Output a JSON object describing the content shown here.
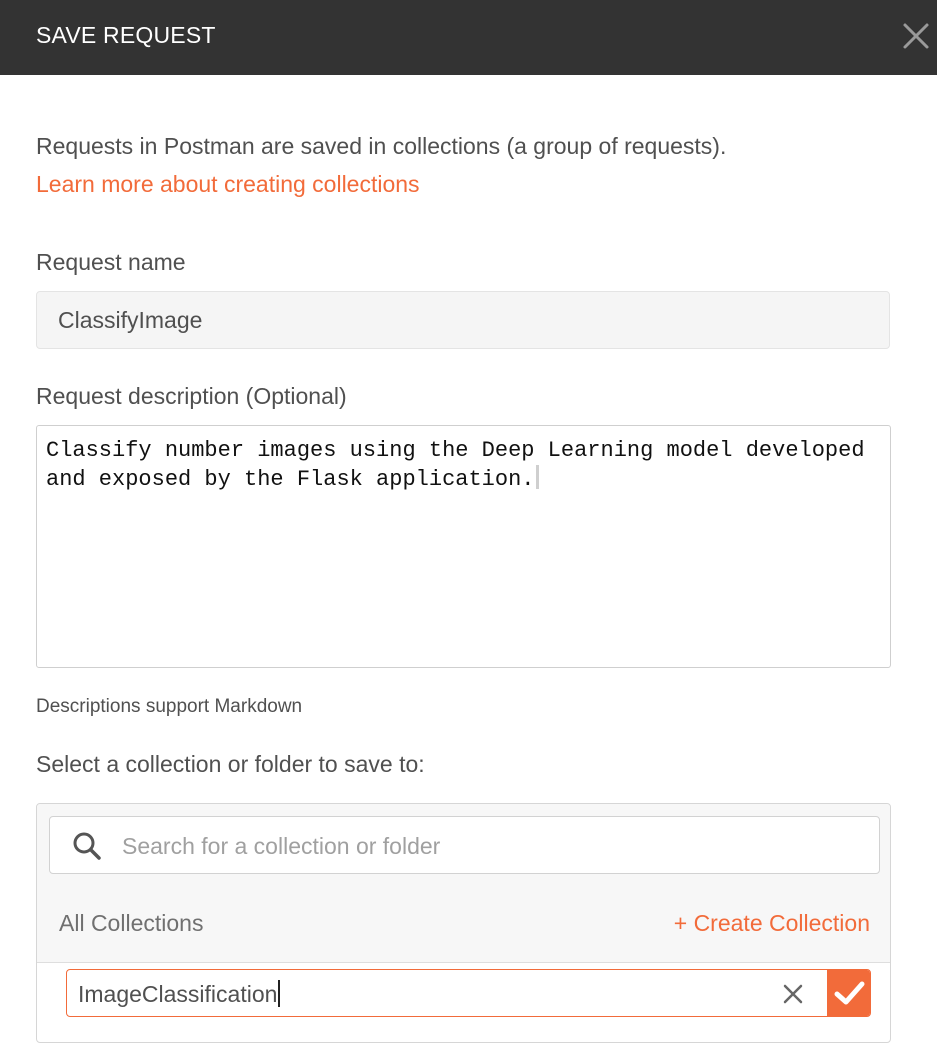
{
  "header": {
    "title": "SAVE REQUEST",
    "close_icon": "close-icon"
  },
  "intro": {
    "text": "Requests in Postman are saved in collections (a group of requests).",
    "link": "Learn more about creating collections"
  },
  "request_name": {
    "label": "Request name",
    "value": "ClassifyImage"
  },
  "request_description": {
    "label": "Request description (Optional)",
    "value": "Classify number images using the Deep Learning model developed\nand exposed by the Flask application.",
    "hint": "Descriptions support Markdown"
  },
  "collection_select": {
    "label": "Select a collection or folder to save to:",
    "search_placeholder": "Search for a collection or folder",
    "search_icon": "search-icon",
    "all_collections": "All Collections",
    "create_collection": "+ Create Collection",
    "new_collection_name": "ImageClassification",
    "clear_icon": "close-icon",
    "confirm_icon": "check-icon"
  },
  "colors": {
    "header_bg": "#333333",
    "accent": "#f26b3a",
    "text": "#505050"
  }
}
